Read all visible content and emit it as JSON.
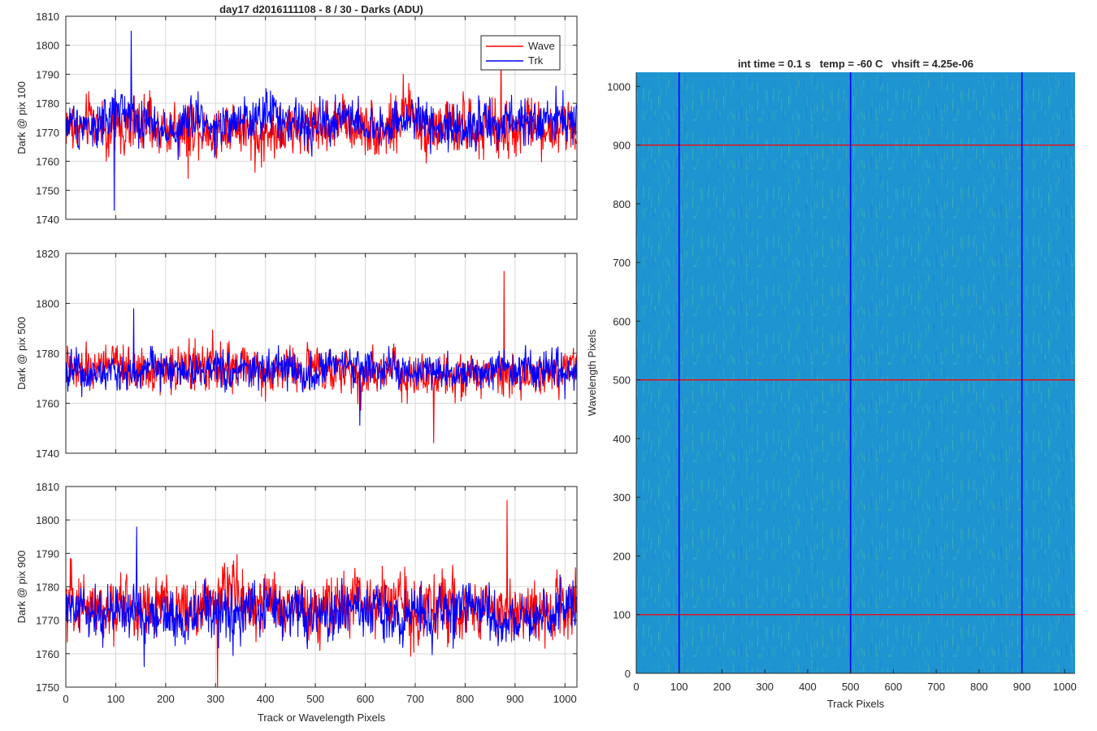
{
  "chart_data": [
    {
      "type": "line",
      "title": "day17 d2016111108 - 8 / 30 - Darks (ADU)",
      "ylabel": "Dark @ pix 100",
      "xlabel": "",
      "xlim": [
        0,
        1024
      ],
      "ylim": [
        1740,
        1810
      ],
      "xticks": [
        0,
        100,
        200,
        300,
        400,
        500,
        600,
        700,
        800,
        900,
        1000
      ],
      "yticks": [
        1740,
        1750,
        1760,
        1770,
        1780,
        1790,
        1800,
        1810
      ],
      "show_xtick_labels": false,
      "grid": true,
      "legend": "top-right",
      "series": [
        {
          "name": "Wave",
          "color": "#ff0000",
          "mean": 1772,
          "noise": 6.5,
          "spike_up": 1801,
          "spike_down": 1754
        },
        {
          "name": "Trk",
          "color": "#0000ff",
          "mean": 1773,
          "noise": 5.5,
          "spike_up": 1805,
          "spike_down": 1743
        }
      ]
    },
    {
      "type": "line",
      "title": "",
      "ylabel": "Dark @ pix 500",
      "xlabel": "",
      "xlim": [
        0,
        1024
      ],
      "ylim": [
        1740,
        1820
      ],
      "xticks": [
        0,
        100,
        200,
        300,
        400,
        500,
        600,
        700,
        800,
        900,
        1000
      ],
      "yticks": [
        1740,
        1760,
        1780,
        1800,
        1820
      ],
      "show_xtick_labels": false,
      "grid": true,
      "legend": "none",
      "series": [
        {
          "name": "Wave",
          "color": "#ff0000",
          "mean": 1773,
          "noise": 6.0,
          "spike_up": 1813,
          "spike_down": 1744
        },
        {
          "name": "Trk",
          "color": "#0000ff",
          "mean": 1773,
          "noise": 5.0,
          "spike_up": 1798,
          "spike_down": 1751
        }
      ]
    },
    {
      "type": "line",
      "title": "",
      "ylabel": "Dark @ pix 900",
      "xlabel": "Track or Wavelength Pixels",
      "xlim": [
        0,
        1024
      ],
      "ylim": [
        1750,
        1810
      ],
      "xticks": [
        0,
        100,
        200,
        300,
        400,
        500,
        600,
        700,
        800,
        900,
        1000
      ],
      "yticks": [
        1750,
        1760,
        1770,
        1780,
        1790,
        1800,
        1810
      ],
      "show_xtick_labels": true,
      "grid": true,
      "legend": "none",
      "series": [
        {
          "name": "Wave",
          "color": "#ff0000",
          "mean": 1774,
          "noise": 6.5,
          "spike_up": 1806,
          "spike_down": 1750
        },
        {
          "name": "Trk",
          "color": "#0000ff",
          "mean": 1772,
          "noise": 5.5,
          "spike_up": 1798,
          "spike_down": 1756
        }
      ]
    },
    {
      "type": "heatmap",
      "title": "int time = 0.1 s   temp = -60 C   vhsift = 4.25e-06",
      "xlabel": "Track Pixels",
      "ylabel": "Wavelength Pixels",
      "xlim": [
        0,
        1024
      ],
      "ylim": [
        0,
        1024
      ],
      "xticks": [
        0,
        100,
        200,
        300,
        400,
        500,
        600,
        700,
        800,
        900,
        1000
      ],
      "yticks": [
        0,
        100,
        200,
        300,
        400,
        500,
        600,
        700,
        800,
        900,
        1000
      ],
      "colormap": "parula",
      "base_color": "#1e95d0",
      "vertical_markers": {
        "color": "#0000ff",
        "values": [
          100,
          500,
          900
        ]
      },
      "horizontal_markers": {
        "color": "#ff0000",
        "values": [
          100,
          500,
          900
        ]
      }
    }
  ]
}
